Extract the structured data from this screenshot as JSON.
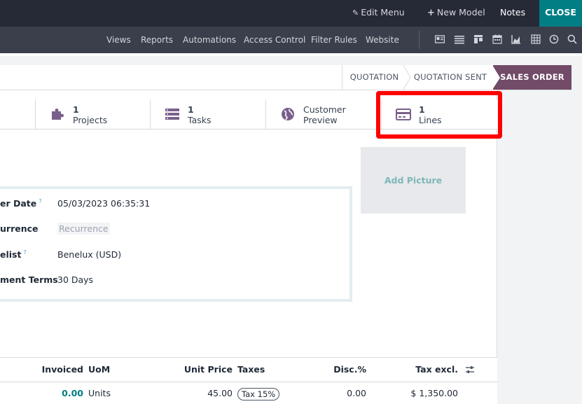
{
  "topbar": {
    "edit_menu": "Edit Menu",
    "new_model": "New Model",
    "notes": "Notes",
    "close": "CLOSE"
  },
  "menubar": {
    "items": [
      "Views",
      "Reports",
      "Automations",
      "Access Control",
      "Filter Rules",
      "Website"
    ],
    "view_icons": [
      "kanban-card-icon",
      "list-icon",
      "kanban-icon",
      "calendar-icon",
      "graph-icon",
      "pivot-icon",
      "activity-icon",
      "search-icon"
    ]
  },
  "status": {
    "stages": [
      "QUOTATION",
      "QUOTATION SENT",
      "SALES ORDER"
    ],
    "active": "SALES ORDER",
    "active_color": "#714b67"
  },
  "smart_buttons": {
    "projects": {
      "value": "1",
      "label": "Projects",
      "icon": "puzzle-icon"
    },
    "tasks": {
      "value": "1",
      "label": "Tasks",
      "icon": "tasks-icon"
    },
    "preview": {
      "label_line1": "Customer",
      "label_line2": "Preview",
      "icon": "globe-icon"
    },
    "lines": {
      "value": "1",
      "label": "Lines",
      "icon": "credit-card-icon"
    }
  },
  "picture": {
    "label": "Add Picture"
  },
  "details": {
    "order_date_label": "er Date",
    "order_date_value": "05/03/2023 06:35:31",
    "recurrence_label": "urrence",
    "recurrence_placeholder": "Recurrence",
    "pricelist_label": "elist",
    "pricelist_value": "Benelux (USD)",
    "payment_terms_label": "ment Terms",
    "payment_terms_value": "30 Days",
    "help_mark": "?"
  },
  "table": {
    "headers": {
      "invoiced": "Invoiced",
      "uom": "UoM",
      "unit_price": "Unit Price",
      "taxes": "Taxes",
      "disc": "Disc.%",
      "tax_excl": "Tax excl."
    },
    "rows": [
      {
        "invoiced": "0.00",
        "uom": "Units",
        "unit_price": "45.00",
        "taxes": "Tax 15%",
        "disc": "0.00",
        "tax_excl": "$ 1,350.00"
      }
    ]
  },
  "colors": {
    "highlight": "#ff0000",
    "accent": "#017e84",
    "brand": "#714b67"
  }
}
